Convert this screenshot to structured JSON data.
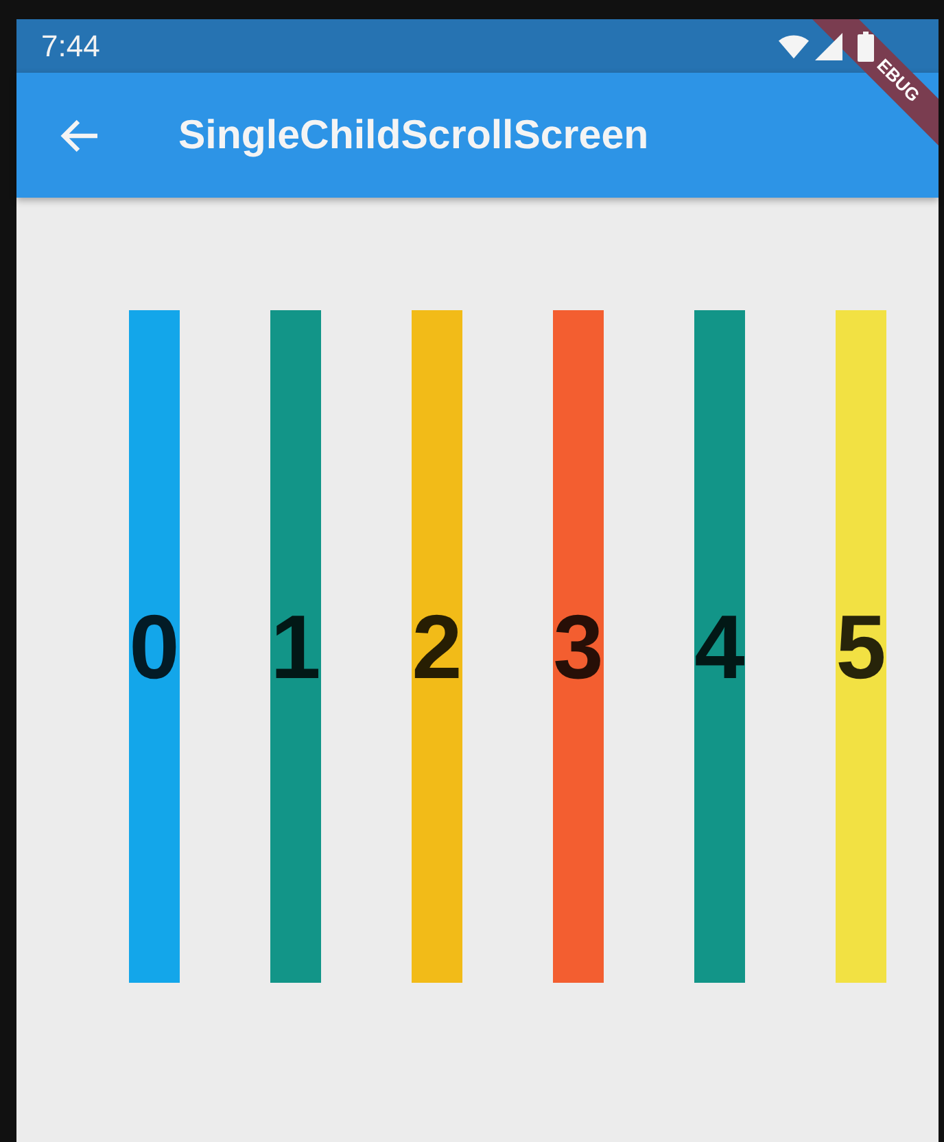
{
  "status_bar": {
    "time": "7:44"
  },
  "app_bar": {
    "title": "SingleChildScrollScreen"
  },
  "debug_banner": {
    "label": "EBUG"
  },
  "columns": [
    {
      "label": "0",
      "color": "#13a6ea"
    },
    {
      "label": "1",
      "color": "#129588"
    },
    {
      "label": "2",
      "color": "#f2bb18"
    },
    {
      "label": "3",
      "color": "#f35e30"
    },
    {
      "label": "4",
      "color": "#129588"
    },
    {
      "label": "5",
      "color": "#f2e143"
    }
  ]
}
